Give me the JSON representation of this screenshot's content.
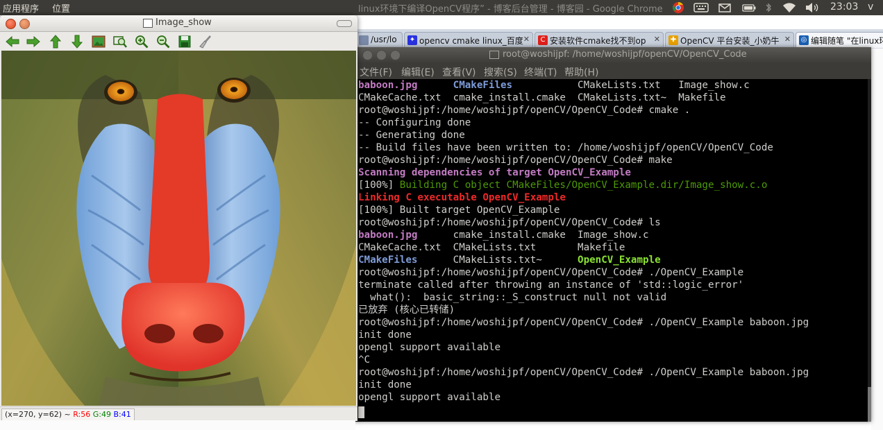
{
  "top_panel": {
    "app_menu": "应用程序",
    "places_menu": "位置",
    "window_title": "linux环境下编译OpenCV程序” - 博客后台管理 - 博客园 - Google Chrome",
    "tray_icons": [
      "chrome-icon",
      "keyboard-icon",
      "mail-icon",
      "battery-icon",
      "bluetooth-icon",
      "wifi-icon",
      "volume-icon"
    ],
    "clock": "23:03",
    "user": "v"
  },
  "chrome": {
    "tabs": [
      {
        "title": "/usr/lo",
        "favicon": "page-icon",
        "color": "#7a8aa8"
      },
      {
        "title": "opencv cmake linux_百度",
        "favicon": "paw-icon",
        "color": "#2932e1"
      },
      {
        "title": "安装软件cmake找不到op",
        "favicon": "c-logo-icon",
        "color": "#e0201b"
      },
      {
        "title": "OpenCV 平台安装_小奶牛",
        "favicon": "color-logo-icon",
        "color": "#e8a000"
      },
      {
        "title": "编辑随笔 \"在linux环",
        "favicon": "globe-icon",
        "color": "#1a5fb4"
      }
    ]
  },
  "terminal": {
    "title": "root@woshijpf: /home/woshijpf/openCV/OpenCV_Code",
    "menu": [
      "文件(F)",
      "编辑(E)",
      "查看(V)",
      "搜索(S)",
      "终端(T)",
      "帮助(H)"
    ],
    "lines": [
      [
        {
          "t": "baboon.jpg",
          "c": "img"
        },
        {
          "t": "      "
        },
        {
          "t": "CMakeFiles",
          "c": "dir"
        },
        {
          "t": "           CMakeLists.txt   Image_show.c"
        }
      ],
      [
        {
          "t": "CMakeCache.txt  cmake_install.cmake  CMakeLists.txt~  Makefile"
        }
      ],
      [
        {
          "t": "root@woshijpf:/home/woshijpf/openCV/OpenCV_Code# cmake ."
        }
      ],
      [
        {
          "t": "-- Configuring done"
        }
      ],
      [
        {
          "t": "-- Generating done"
        }
      ],
      [
        {
          "t": "-- Build files have been written to: /home/woshijpf/openCV/OpenCV_Code"
        }
      ],
      [
        {
          "t": "root@woshijpf:/home/woshijpf/openCV/OpenCV_Code# make"
        }
      ],
      [
        {
          "t": "Scanning dependencies of target OpenCV_Example",
          "c": "scan"
        }
      ],
      [
        {
          "t": "[100%] "
        },
        {
          "t": "Building C object CMakeFiles/OpenCV_Example.dir/Image_show.c.o",
          "c": "grn"
        }
      ],
      [
        {
          "t": "Linking C executable OpenCV_Example",
          "c": "red"
        }
      ],
      [
        {
          "t": "[100%] Built target OpenCV_Example"
        }
      ],
      [
        {
          "t": "root@woshijpf:/home/woshijpf/openCV/OpenCV_Code# ls"
        }
      ],
      [
        {
          "t": "baboon.jpg",
          "c": "img"
        },
        {
          "t": "      cmake_install.cmake  Image_show.c"
        }
      ],
      [
        {
          "t": "CMakeCache.txt  CMakeLists.txt       Makefile"
        }
      ],
      [
        {
          "t": "CMakeFiles",
          "c": "dir"
        },
        {
          "t": "      CMakeLists.txt~      "
        },
        {
          "t": "OpenCV_Example",
          "c": "exe"
        }
      ],
      [
        {
          "t": "root@woshijpf:/home/woshijpf/openCV/OpenCV_Code# ./OpenCV_Example"
        }
      ],
      [
        {
          "t": "terminate called after throwing an instance of 'std::logic_error'"
        }
      ],
      [
        {
          "t": "  what():  basic_string::_S_construct null not valid"
        }
      ],
      [
        {
          "t": "已放弃 (核心已转储)"
        }
      ],
      [
        {
          "t": "root@woshijpf:/home/woshijpf/openCV/OpenCV_Code# ./OpenCV_Example baboon.jpg"
        }
      ],
      [
        {
          "t": "init done"
        }
      ],
      [
        {
          "t": "opengl support available"
        }
      ],
      [
        {
          "t": "^C"
        }
      ],
      [
        {
          "t": "root@woshijpf:/home/woshijpf/openCV/OpenCV_Code# ./OpenCV_Example baboon.jpg"
        }
      ],
      [
        {
          "t": "init done"
        }
      ],
      [
        {
          "t": "opengl support available"
        }
      ]
    ]
  },
  "image_window": {
    "title": "Image_show",
    "toolbar": [
      "arrow-left-icon",
      "arrow-right-icon",
      "arrow-up-icon",
      "arrow-down-icon",
      "image-icon",
      "zoom-fit-icon",
      "zoom-in-icon",
      "zoom-out-icon",
      "save-icon",
      "brush-icon"
    ],
    "status": {
      "coords": "(x=270, y=62) ~",
      "r": "R:56",
      "g": "G:49",
      "b": "B:41"
    }
  }
}
